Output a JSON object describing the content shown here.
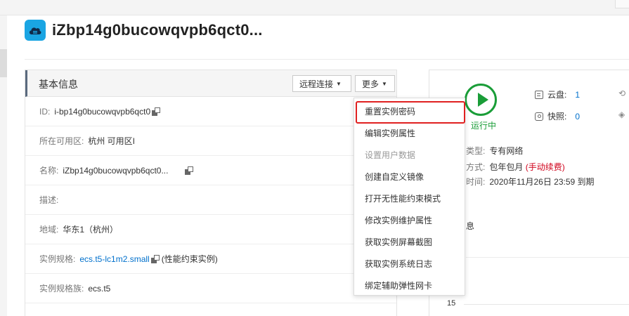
{
  "header": {
    "title": "iZbp14g0bucowqvpb6qct0...",
    "badge_color": "#1aa5e3",
    "icon": "cloud-server-icon"
  },
  "basic_info": {
    "title": "基本信息",
    "remote_button": "远程连接",
    "more_button": "更多",
    "rows": {
      "id": {
        "label": "ID:",
        "value": "i-bp14g0bucowqvpb6qct0"
      },
      "zone": {
        "label": "所在可用区:",
        "value": "杭州 可用区I"
      },
      "name": {
        "label": "名称:",
        "value": "iZbp14g0bucowqvpb6qct0..."
      },
      "desc": {
        "label": "描述:",
        "value": ""
      },
      "region": {
        "label": "地域:",
        "value": "华东1（杭州）"
      },
      "spec": {
        "label": "实例规格:",
        "value": "ecs.t5-lc1m2.small",
        "note": "(性能约束实例)"
      },
      "family": {
        "label": "实例规格族:",
        "value": "ecs.t5"
      }
    }
  },
  "more_menu": {
    "items": [
      {
        "label": "重置实例密码",
        "highlighted": true,
        "disabled": false
      },
      {
        "label": "编辑实例属性",
        "highlighted": false,
        "disabled": false
      },
      {
        "label": "设置用户数据",
        "highlighted": false,
        "disabled": true
      },
      {
        "label": "创建自定义镜像",
        "highlighted": false,
        "disabled": false
      },
      {
        "label": "打开无性能约束模式",
        "highlighted": false,
        "disabled": false
      },
      {
        "label": "修改实例维护属性",
        "highlighted": false,
        "disabled": false
      },
      {
        "label": "获取实例屏幕截图",
        "highlighted": false,
        "disabled": false
      },
      {
        "label": "获取实例系统日志",
        "highlighted": false,
        "disabled": false
      },
      {
        "label": "绑定辅助弹性网卡",
        "highlighted": false,
        "disabled": false
      }
    ],
    "highlight_color": "#e02020"
  },
  "status": {
    "label": "运行中",
    "color": "#1a9d38",
    "disk_label": "云盘:",
    "disk_count": "1",
    "snapshot_label": "快照:",
    "snapshot_count": "0"
  },
  "config": {
    "network_key": "类型:",
    "network_value": "专有网络",
    "billing_key": "方式:",
    "billing_value": "包年包月",
    "billing_note": "(手动续费)",
    "expire_key": "时间:",
    "expire_value": "2020年11月26日 23:59 到期",
    "partial_text": "息",
    "axis_tick": "15"
  },
  "colors": {
    "link": "#0070cc",
    "warning": "#d0021b"
  }
}
